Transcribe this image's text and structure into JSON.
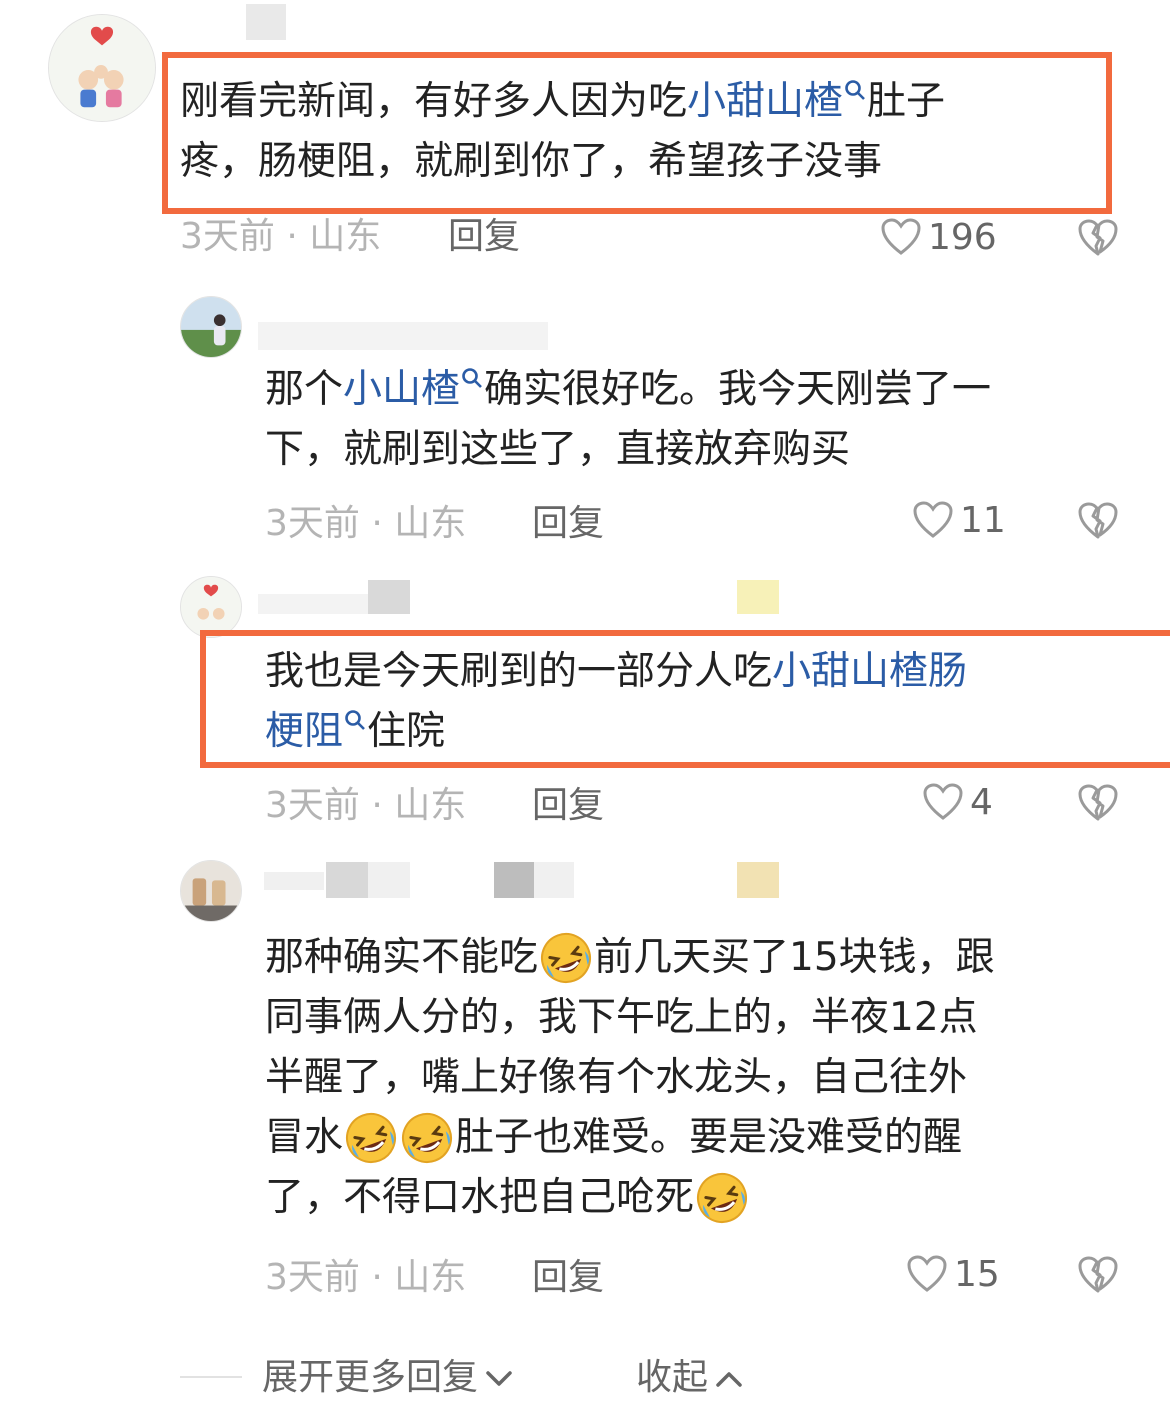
{
  "comments": [
    {
      "line1_a": "刚看完新闻，有好多人因为吃",
      "line1_link": "小甜山楂",
      "line1_b": "肚子",
      "line2": "疼，肠梗阻，就刷到你了，希望孩子没事",
      "time_location": "3天前 · 山东",
      "reply_label": "回复",
      "likes": "196"
    },
    {
      "line1_a": "那个",
      "line1_link": "小山楂",
      "line1_b": "确实很好吃。我今天刚尝了一",
      "line2": "下，就刷到这些了，直接放弃购买",
      "time_location": "3天前 · 山东",
      "reply_label": "回复",
      "likes": "11"
    },
    {
      "line1_a": "我也是今天刷到的一部分人吃",
      "line1_link": "小甜山楂肠",
      "line2_link": "梗阻",
      "line2_b": "住院",
      "time_location": "3天前 · 山东",
      "reply_label": "回复",
      "likes": "4"
    },
    {
      "line1_a": "那种确实不能吃",
      "line1_b": "前几天买了15块钱，跟",
      "line2": "同事俩人分的，我下午吃上的，半夜12点",
      "line3": "半醒了，嘴上好像有个水龙头，自己往外",
      "line4_a": "冒水",
      "line4_b": "肚子也难受。要是没难受的醒",
      "line5": "了，不得口水把自己呛死",
      "time_location": "3天前 · 山东",
      "reply_label": "回复",
      "likes": "15"
    }
  ],
  "footer": {
    "expand_label": "展开更多回复",
    "collapse_label": "收起"
  },
  "icons": {
    "search": "search-icon",
    "heart": "heart-icon",
    "dislike": "broken-heart-icon",
    "emoji": "rolling-laughing-emoji",
    "chevron_down": "chevron-down-icon",
    "chevron_up": "chevron-up-icon"
  },
  "colors": {
    "highlight_border": "#f26a3e",
    "link": "#2b5ca6"
  }
}
